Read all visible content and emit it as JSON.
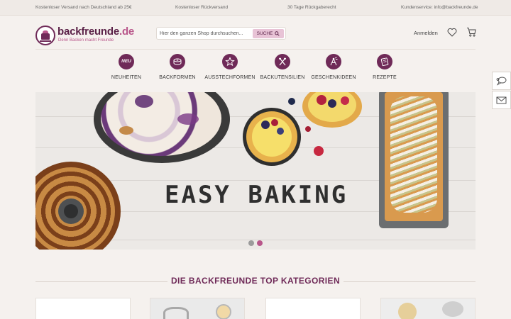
{
  "topbar": {
    "shipping": "Kostenloser Versand nach Deutschland ab 25€",
    "returns": "Kostenloser Rückversand",
    "guarantee": "30 Tage Rückgaberecht",
    "service": "Kundenservice: info@backfreunde.de"
  },
  "header": {
    "logo_main": "backfreunde",
    "logo_tld": ".de",
    "tagline": "Denn Backen macht Freunde",
    "search_placeholder": "Hier den ganzen Shop durchsuchen...",
    "search_button": "SUCHE",
    "login": "Anmelden",
    "icons": {
      "wishlist": "heart-icon",
      "cart": "cart-icon",
      "search": "magnifier-icon"
    }
  },
  "nav": {
    "items": [
      {
        "label": "NEUHEITEN",
        "badge": "NEU",
        "icon": "new-badge-icon"
      },
      {
        "label": "BACKFORMEN",
        "icon": "cake-pan-icon"
      },
      {
        "label": "AUSSTECHFORMEN",
        "icon": "star-cutter-icon"
      },
      {
        "label": "BACKUTENSILIEN",
        "icon": "utensils-icon"
      },
      {
        "label": "GESCHENKIDEEN",
        "icon": "gift-icon"
      },
      {
        "label": "REZEPTE",
        "icon": "recipe-book-icon"
      }
    ]
  },
  "side_tools": {
    "chat": "chat-icon",
    "mail": "mail-icon"
  },
  "hero": {
    "title": "EASY BAKING",
    "slides": 2,
    "active_slide": 2
  },
  "categories_section": {
    "title": "DIE BACKFREUNDE TOP KATEGORIEN"
  },
  "colors": {
    "brand": "#6f2a58",
    "brand_light": "#b8568a",
    "button": "#e8c3d6",
    "background": "#f5f1ee"
  }
}
